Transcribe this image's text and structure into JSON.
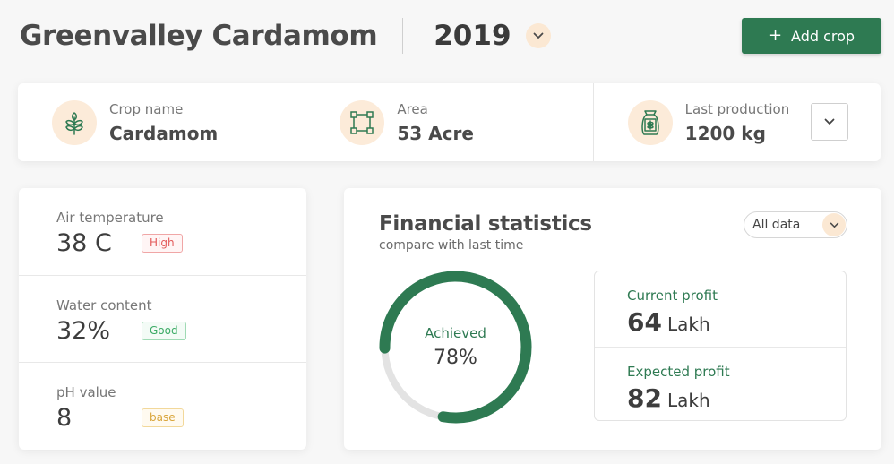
{
  "header": {
    "farm_name": "Greenvalley Cardamom",
    "year": "2019",
    "add_button": "Add crop"
  },
  "info": {
    "crop": {
      "label": "Crop name",
      "value": "Cardamom",
      "icon": "leaf-icon"
    },
    "area": {
      "label": "Area",
      "value": "53 Acre",
      "icon": "area-square-icon"
    },
    "production": {
      "label": "Last production",
      "value": "1200 kg",
      "icon": "grain-sack-icon"
    }
  },
  "metrics": [
    {
      "label": "Air temperature",
      "value": "38 C",
      "badge": "High",
      "badge_color": "#e35b5b"
    },
    {
      "label": "Water content",
      "value": "32%",
      "badge": "Good",
      "badge_color": "#3aaa64"
    },
    {
      "label": "pH value",
      "value": "8",
      "badge": "base",
      "badge_color": "#d9a53b"
    }
  ],
  "financial": {
    "title": "Financial statistics",
    "subtitle": "compare with last time",
    "filter": "All data",
    "gauge": {
      "label": "Achieved",
      "value_text": "78%",
      "fraction": 0.78
    },
    "current": {
      "label": "Current profit",
      "amount": "64",
      "unit": "Lakh"
    },
    "expected": {
      "label": "Expected profit",
      "amount": "82",
      "unit": "Lakh"
    }
  },
  "colors": {
    "accent": "#2e7a52",
    "icon_bg": "#fcebd9",
    "gauge_track": "#e3e3e3"
  }
}
